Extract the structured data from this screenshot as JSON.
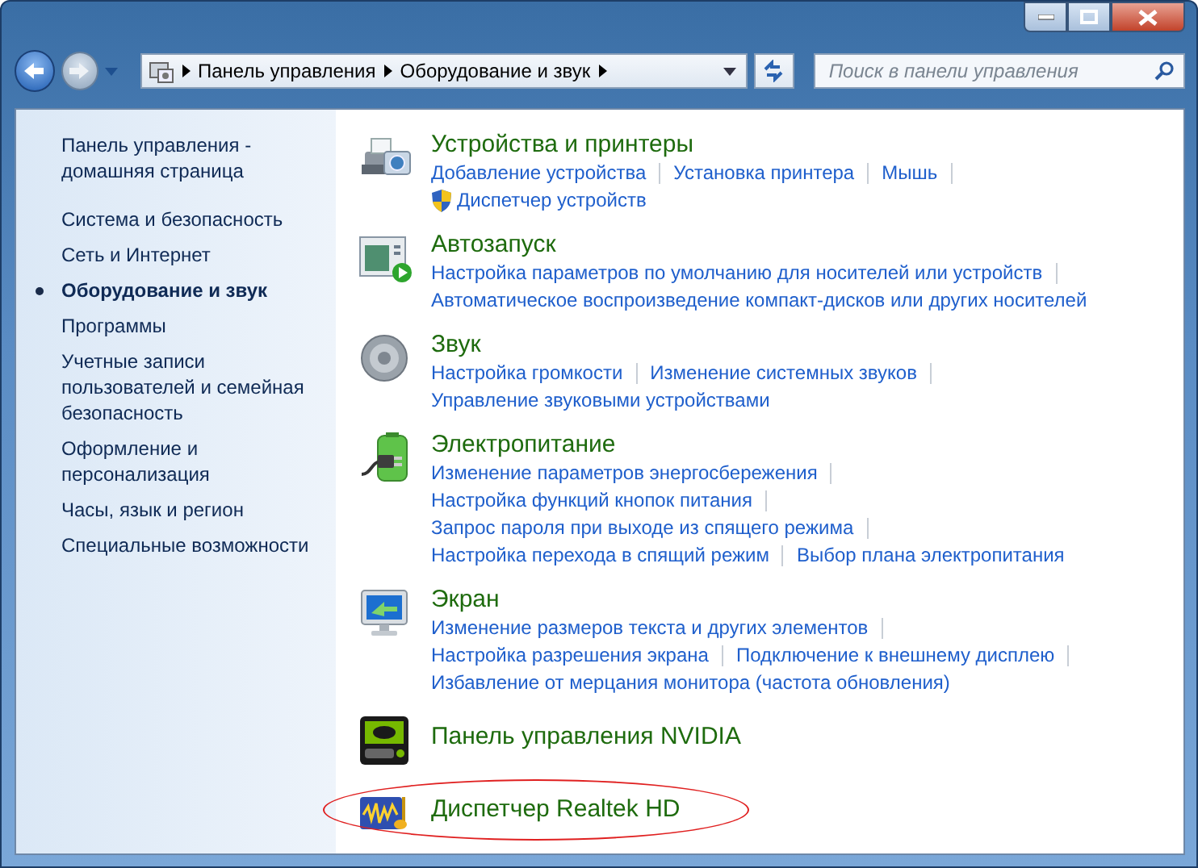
{
  "address_bar": {
    "breadcrumbs": [
      "Панель управления",
      "Оборудование и звук"
    ]
  },
  "search": {
    "placeholder": "Поиск в панели управления"
  },
  "sidebar": {
    "items": [
      {
        "label": "Панель управления - домашняя страница",
        "selected": false
      },
      {
        "label": "Система и безопасность",
        "selected": false
      },
      {
        "label": "Сеть и Интернет",
        "selected": false
      },
      {
        "label": "Оборудование и звук",
        "selected": true
      },
      {
        "label": "Программы",
        "selected": false
      },
      {
        "label": "Учетные записи пользователей и семейная безопасность",
        "selected": false
      },
      {
        "label": "Оформление и персонализация",
        "selected": false
      },
      {
        "label": "Часы, язык и регион",
        "selected": false
      },
      {
        "label": "Специальные возможности",
        "selected": false
      }
    ]
  },
  "categories": [
    {
      "kind": "devices",
      "title": "Устройства и принтеры",
      "highlighted": false,
      "link_rows": [
        [
          {
            "text": "Добавление устройства"
          },
          {
            "text": "Установка принтера"
          },
          {
            "text": "Мышь"
          }
        ],
        [
          {
            "text": "Диспетчер устройств",
            "shield": true
          }
        ]
      ]
    },
    {
      "kind": "autoplay",
      "title": "Автозапуск",
      "highlighted": false,
      "link_rows": [
        [
          {
            "text": "Настройка параметров по умолчанию для носителей или устройств"
          }
        ],
        [
          {
            "text": "Автоматическое воспроизведение компакт-дисков или других носителей"
          }
        ]
      ]
    },
    {
      "kind": "sound",
      "title": "Звук",
      "highlighted": false,
      "link_rows": [
        [
          {
            "text": "Настройка громкости"
          },
          {
            "text": "Изменение системных звуков"
          }
        ],
        [
          {
            "text": "Управление звуковыми устройствами"
          }
        ]
      ]
    },
    {
      "kind": "power",
      "title": "Электропитание",
      "highlighted": false,
      "link_rows": [
        [
          {
            "text": "Изменение параметров энергосбережения"
          }
        ],
        [
          {
            "text": "Настройка функций кнопок питания"
          }
        ],
        [
          {
            "text": "Запрос пароля при выходе из спящего режима"
          }
        ],
        [
          {
            "text": "Настройка перехода в спящий режим"
          },
          {
            "text": "Выбор плана электропитания"
          }
        ]
      ]
    },
    {
      "kind": "display",
      "title": "Экран",
      "highlighted": false,
      "link_rows": [
        [
          {
            "text": "Изменение размеров текста и других элементов"
          }
        ],
        [
          {
            "text": "Настройка разрешения экрана"
          },
          {
            "text": "Подключение к внешнему дисплею"
          }
        ],
        [
          {
            "text": "Избавление от мерцания монитора (частота обновления)"
          }
        ]
      ]
    },
    {
      "kind": "nvidia",
      "title": "Панель управления NVIDIA",
      "highlighted": false
    },
    {
      "kind": "realtek",
      "title": "Диспетчер Realtek HD",
      "highlighted": true
    }
  ]
}
